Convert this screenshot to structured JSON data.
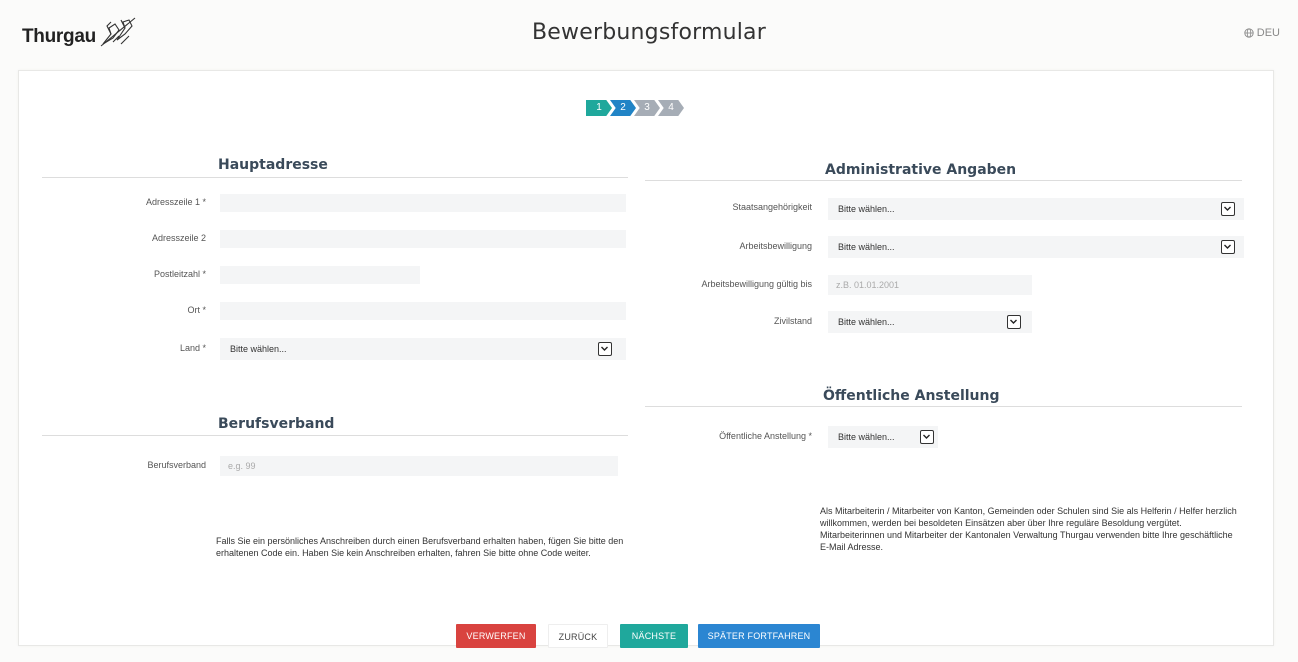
{
  "header": {
    "logo_text": "Thurgau",
    "title": "Bewerbungsformular",
    "language": "DEU"
  },
  "stepper": {
    "steps": [
      "1",
      "2",
      "3",
      "4"
    ],
    "current": 2
  },
  "hauptadresse": {
    "title": "Hauptadresse",
    "fields": [
      {
        "label": "Adresszeile 1 *",
        "value": ""
      },
      {
        "label": "Adresszeile 2",
        "value": ""
      },
      {
        "label": "Postleitzahl *",
        "value": ""
      },
      {
        "label": "Ort *",
        "value": ""
      }
    ],
    "land": {
      "label": "Land *",
      "value": "Bitte wählen..."
    }
  },
  "berufsverband": {
    "title": "Berufsverband",
    "label": "Berufsverband",
    "placeholder": "e.g. 99",
    "note": "Falls Sie ein persönliches Anschreiben durch einen Berufsverband erhalten haben, fügen Sie bitte den erhaltenen Code ein. Haben Sie kein Anschreiben erhalten, fahren Sie bitte ohne Code weiter."
  },
  "administrative": {
    "title": "Administrative Angaben",
    "staatsangehoerigkeit": {
      "label": "Staatsangehörigkeit",
      "value": "Bitte wählen..."
    },
    "arbeitsbewilligung": {
      "label": "Arbeitsbewilligung",
      "value": "Bitte wählen..."
    },
    "gueltig_bis": {
      "label": "Arbeitsbewilligung gültig bis",
      "placeholder": "z.B. 01.01.2001"
    },
    "zivilstand": {
      "label": "Zivilstand",
      "value": "Bitte wählen..."
    }
  },
  "oeffentliche": {
    "title": "Öffentliche Anstellung",
    "label": "Öffentliche Anstellung *",
    "value": "Bitte wählen...",
    "note": "Als Mitarbeiterin / Mitarbeiter von Kanton, Gemeinden oder Schulen sind Sie als Helferin / Helfer herzlich willkommen, werden bei besoldeten Einsätzen aber über Ihre reguläre Besoldung vergütet. Mitarbeiterinnen und Mitarbeiter der Kantonalen Verwaltung Thurgau verwenden bitte Ihre geschäftliche E-Mail Adresse."
  },
  "buttons": {
    "discard": "VERWERFEN",
    "back": "ZURÜCK",
    "next": "NÄCHSTE",
    "later": "SPÄTER FORTFAHREN"
  },
  "colors": {
    "teal": "#1fa89c",
    "blue": "#2184c6",
    "grey": "#a6adb6",
    "red": "#d9433f"
  }
}
